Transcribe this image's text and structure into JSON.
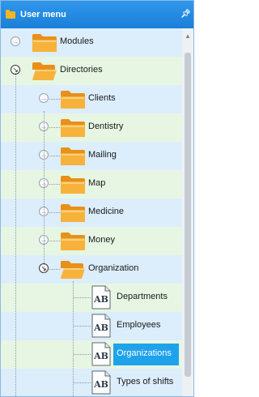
{
  "panel": {
    "title": "User menu",
    "pin_icon": "pin-icon"
  },
  "tree": {
    "root": [
      {
        "label": "Modules",
        "expanded": false
      },
      {
        "label": "Directories",
        "expanded": true
      }
    ],
    "directories": [
      {
        "label": "Clients"
      },
      {
        "label": "Dentistry"
      },
      {
        "label": "Mailing"
      },
      {
        "label": "Map"
      },
      {
        "label": "Medicine"
      },
      {
        "label": "Money"
      },
      {
        "label": "Organization",
        "expanded": true
      }
    ],
    "organization": [
      {
        "label": "Departments",
        "selected": false
      },
      {
        "label": "Employees",
        "selected": false
      },
      {
        "label": "Organizations",
        "selected": true
      },
      {
        "label": "Types of shifts",
        "selected": false
      }
    ],
    "doc_icon_text": "AB"
  },
  "colors": {
    "header": "#1a7fd8",
    "selection": "#1fa2ec",
    "folder": "#f5a623",
    "row_blue": "#dcedfb",
    "row_green": "#e6f6e3"
  }
}
